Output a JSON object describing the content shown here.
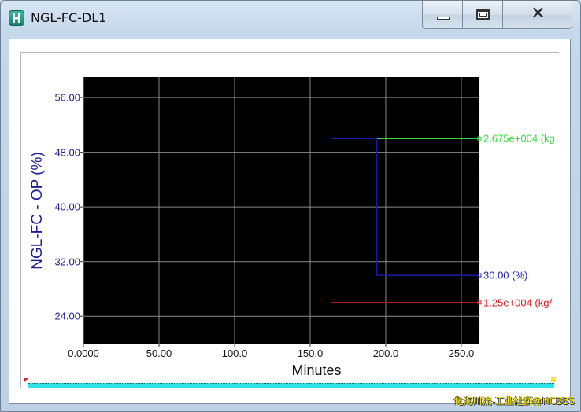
{
  "window": {
    "title": "NGL-FC-DL1",
    "app_icon": "honeywell-h-icon",
    "controls": {
      "minimize_icon": "minimize-icon",
      "maximize_icon": "maximize-icon",
      "close_icon": "close-icon",
      "close_glyph": "✕"
    }
  },
  "chart_data": {
    "type": "line",
    "title": "",
    "xlabel": "Minutes",
    "ylabel": "NGL-FC - OP (%)",
    "xlim": [
      0,
      262
    ],
    "ylim": [
      20,
      59
    ],
    "x_ticks": [
      "0.0000",
      "50.00",
      "100.0",
      "150.0",
      "200.0",
      "250.0"
    ],
    "x_tick_values": [
      0,
      50,
      100,
      150,
      200,
      250
    ],
    "y_ticks": [
      "56.00",
      "48.00",
      "40.00",
      "32.00",
      "24.00"
    ],
    "y_tick_values": [
      56,
      48,
      40,
      32,
      24
    ],
    "grid": true,
    "background": "#000000",
    "series": [
      {
        "color": "#3cd63c",
        "points": [
          [
            164,
            50
          ],
          [
            262,
            50
          ]
        ],
        "end_label": "2.675e+004 (kg"
      },
      {
        "color": "#1a1aa8",
        "points": [
          [
            164,
            50
          ],
          [
            194,
            50
          ],
          [
            194,
            30
          ],
          [
            262,
            30
          ]
        ],
        "end_label": "30.00 (%)"
      },
      {
        "color": "#d42020",
        "points": [
          [
            164,
            26
          ],
          [
            262,
            26
          ]
        ],
        "end_label": "1.25e+004 (kg/"
      }
    ]
  },
  "colors": {
    "axis_text": "#1c1c96",
    "scrollbar": "#2fe4ea"
  },
  "watermark": "化海川流-工业社群@HCBBS"
}
